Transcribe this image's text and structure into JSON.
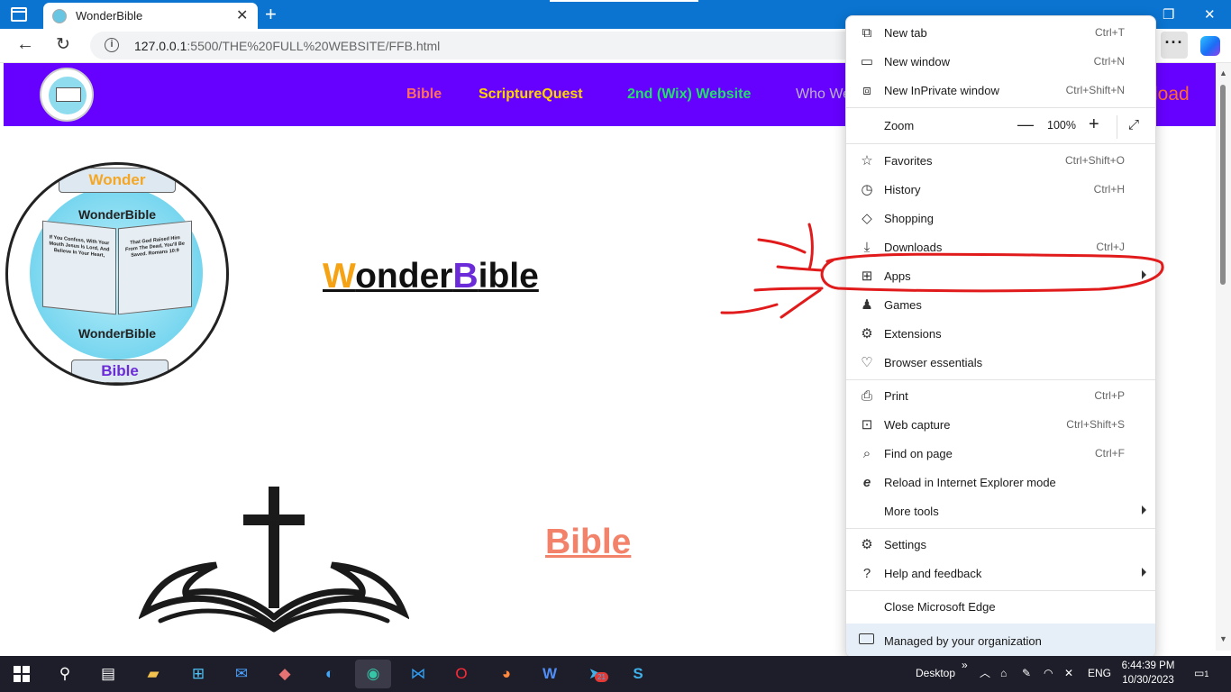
{
  "browser": {
    "tab_title": "WonderBible",
    "url_host": "127.0.0.1",
    "url_path": ":5500/THE%20FULL%20WEBSITE/FFB.html"
  },
  "site": {
    "nav_links": [
      {
        "label": "Bible",
        "color": "#ff6f61"
      },
      {
        "label": "ScriptureQuest",
        "color": "#ffd400"
      },
      {
        "label": "2nd (Wix) Website",
        "color": "#22e06a"
      },
      {
        "label": "Who We",
        "color": "#bdb3d6"
      }
    ],
    "nav_partial_right": "load",
    "logo_banner_top": "Wonder",
    "logo_banner_bottom": "Bible",
    "logo_word": "WonderBible",
    "logo_book_left": "If You Confess, With Your Mouth Jesus Is Lord, And Believe In Your Heart,",
    "logo_book_right": "That God Raised Him From The Dead, You'll Be Saved. Romans 10:9",
    "title_w": "W",
    "title_rest1": "onder",
    "title_b": "B",
    "title_rest2": "ible",
    "bible_heading": "Bible"
  },
  "menu": {
    "items": [
      {
        "icon": "new-tab-icon",
        "label": "New tab",
        "shortcut": "Ctrl+T"
      },
      {
        "icon": "new-window-icon",
        "label": "New window",
        "shortcut": "Ctrl+N"
      },
      {
        "icon": "inprivate-icon",
        "label": "New InPrivate window",
        "shortcut": "Ctrl+Shift+N"
      },
      {
        "icon": "favorites-icon",
        "label": "Favorites",
        "shortcut": "Ctrl+Shift+O"
      },
      {
        "icon": "history-icon",
        "label": "History",
        "shortcut": "Ctrl+H"
      },
      {
        "icon": "shopping-icon",
        "label": "Shopping",
        "shortcut": ""
      },
      {
        "icon": "download-icon",
        "label": "Downloads",
        "shortcut": "Ctrl+J"
      },
      {
        "icon": "apps-icon",
        "label": "Apps",
        "shortcut": ""
      },
      {
        "icon": "games-icon",
        "label": "Games",
        "shortcut": ""
      },
      {
        "icon": "extensions-icon",
        "label": "Extensions",
        "shortcut": ""
      },
      {
        "icon": "browser-essentials-icon",
        "label": "Browser essentials",
        "shortcut": ""
      },
      {
        "icon": "print-icon",
        "label": "Print",
        "shortcut": "Ctrl+P"
      },
      {
        "icon": "web-capture-icon",
        "label": "Web capture",
        "shortcut": "Ctrl+Shift+S"
      },
      {
        "icon": "find-icon",
        "label": "Find on page",
        "shortcut": "Ctrl+F"
      },
      {
        "icon": "ie-mode-icon",
        "label": "Reload in Internet Explorer mode",
        "shortcut": ""
      },
      {
        "icon": "",
        "label": "More tools",
        "shortcut": ""
      },
      {
        "icon": "settings-icon",
        "label": "Settings",
        "shortcut": ""
      },
      {
        "icon": "help-icon",
        "label": "Help and feedback",
        "shortcut": ""
      },
      {
        "icon": "",
        "label": "Close Microsoft Edge",
        "shortcut": ""
      }
    ],
    "zoom_label": "Zoom",
    "zoom_value": "100%",
    "managed": "Managed by your organization"
  },
  "taskbar": {
    "desktop_label": "Desktop",
    "language": "ENG",
    "time": "6:44:39 PM",
    "date": "10/30/2023",
    "telegram_badge": "21",
    "notification_count": "1"
  },
  "colors": {
    "site_nav_bg": "#6600ff",
    "titlebar_bg": "#0a74d0",
    "annotation_red": "#e11b1b"
  }
}
